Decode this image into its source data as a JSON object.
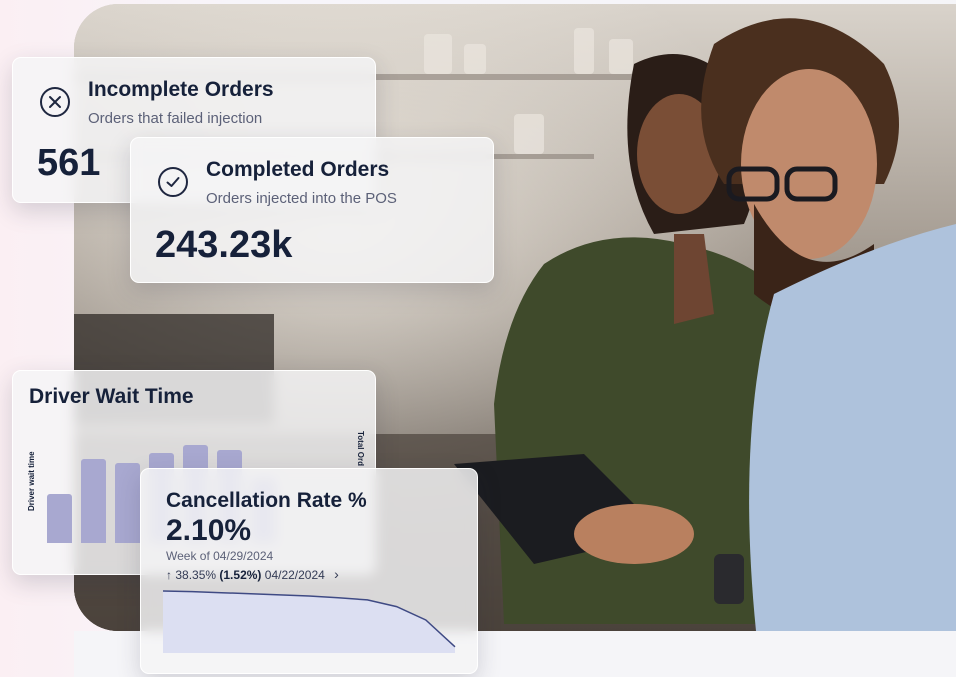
{
  "incomplete_orders": {
    "title": "Incomplete Orders",
    "subtitle": "Orders that failed injection",
    "value": "561"
  },
  "completed_orders": {
    "title": "Completed Orders",
    "subtitle": "Orders injected into the POS",
    "value": "243.23k"
  },
  "driver_wait_time": {
    "title": "Driver Wait Time",
    "y_axis_label": "Driver wait time",
    "right_axis_label": "Total Ord",
    "bars": [
      {
        "value": 0.47
      },
      {
        "value": 0.8
      },
      {
        "value": 0.76
      },
      {
        "value": 0.86
      },
      {
        "value": 0.93
      },
      {
        "value": 0.89
      },
      {
        "value": 0.62
      }
    ]
  },
  "cancellation_rate": {
    "title": "Cancellation Rate %",
    "value": "2.10%",
    "week_label": "Week of 04/29/2024",
    "trend_arrow": "↑",
    "trend_percent": "38.35%",
    "trend_delta": "(1.52%)",
    "compare_date": "04/22/2024",
    "chevron": "›",
    "line_points": [
      1.0,
      0.99,
      0.97,
      0.95,
      0.93,
      0.91,
      0.88,
      0.84,
      0.72,
      0.48,
      0.0
    ]
  },
  "colors": {
    "text_dark": "#16213a",
    "bar": "#a8a8d0",
    "area_fill": "#dcdff2",
    "area_line": "#3f4a84"
  }
}
